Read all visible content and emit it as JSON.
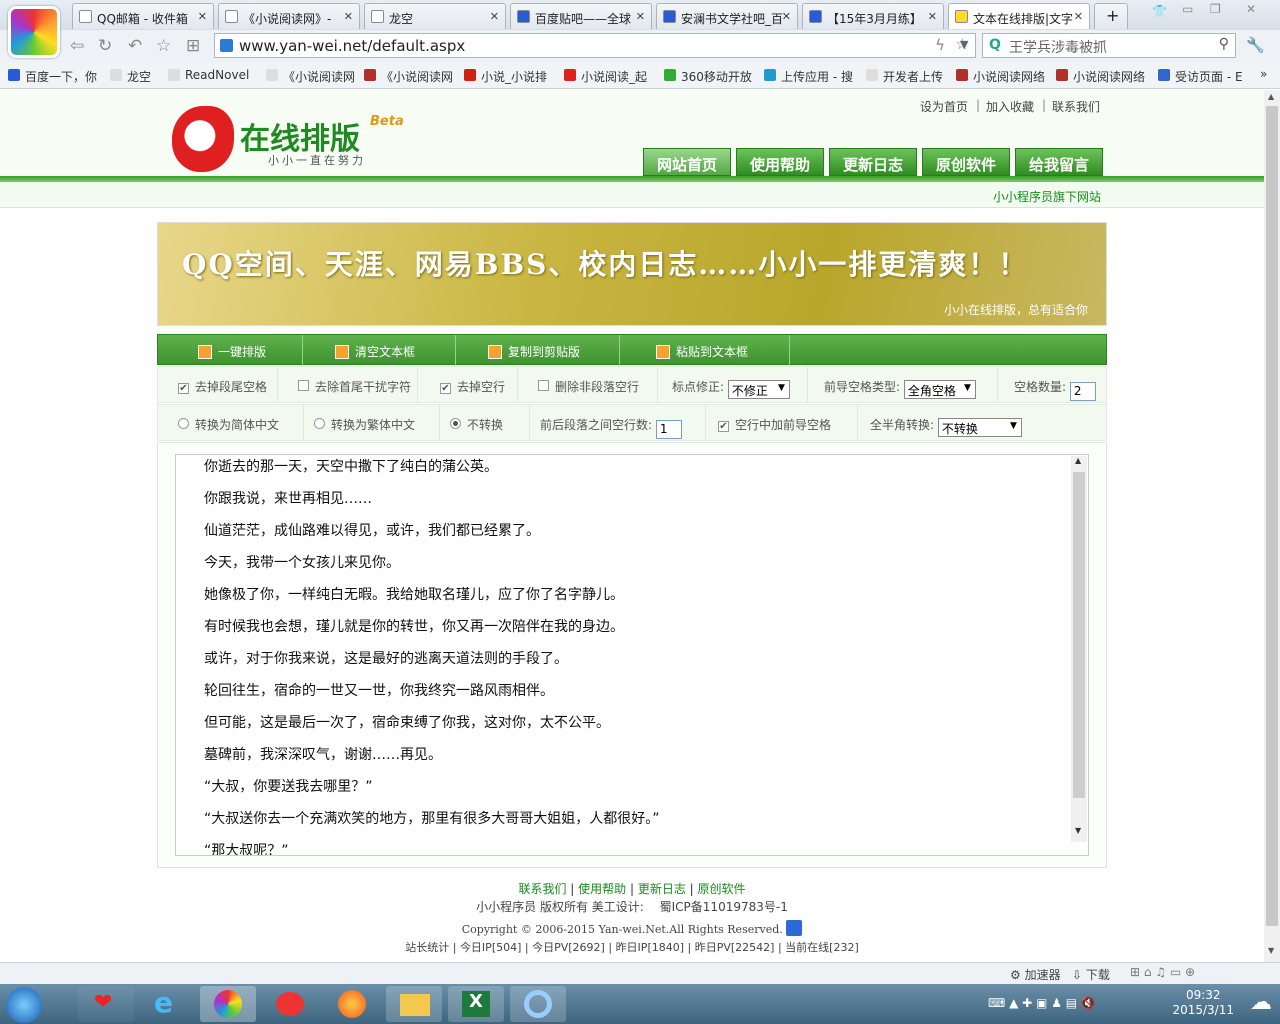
{
  "browser": {
    "tabs": [
      {
        "label": "QQ邮箱 - 收件箱"
      },
      {
        "label": "《小说阅读网》-"
      },
      {
        "label": "龙空"
      },
      {
        "label": "百度贴吧——全球"
      },
      {
        "label": "安澜书文学社吧_百"
      },
      {
        "label": "【15年3月月练】"
      },
      {
        "label": "文本在线排版|文字"
      }
    ],
    "new_tab": "+",
    "url": "www.yan-wei.net/default.aspx",
    "search_value": "王学兵涉毒被抓",
    "bookmarks": [
      {
        "label": "百度一下，你",
        "color": "#2a5bd7"
      },
      {
        "label": "龙空",
        "color": "#ddd"
      },
      {
        "label": "ReadNovel",
        "color": "#ddd"
      },
      {
        "label": "《小说阅读网",
        "color": "#ddd"
      },
      {
        "label": "《小说阅读网",
        "color": "#b0302a"
      },
      {
        "label": "小说_小说排",
        "color": "#c21"
      },
      {
        "label": "小说阅读_起",
        "color": "#d22"
      },
      {
        "label": "360移动开放",
        "color": "#3a3"
      },
      {
        "label": "上传应用 - 搜",
        "color": "#29c"
      },
      {
        "label": "开发者上传",
        "color": "#ddd"
      },
      {
        "label": "小说阅读网络",
        "color": "#b0302a"
      },
      {
        "label": "小说阅读网络",
        "color": "#b0302a"
      },
      {
        "label": "受访页面 - E",
        "color": "#36c"
      }
    ],
    "more": "»"
  },
  "site": {
    "logo_text": "在线排版",
    "logo_beta": "Beta",
    "logo_slogan": "小小一直在努力",
    "top_links": [
      "设为首页",
      "加入收藏",
      "联系我们"
    ],
    "nav": [
      "网站首页",
      "使用帮助",
      "更新日志",
      "原创软件",
      "给我留言"
    ],
    "subtitle": "小小程序员旗下网站",
    "banner_text": "QQ空间、天涯、网易BBS、校内日志……小小一排更清爽！！",
    "banner_small": "小小在线排版，总有适合你",
    "toolbar": [
      "一键排版",
      "清空文本框",
      "复制到剪贴版",
      "粘贴到文本框"
    ],
    "options1": {
      "trim_tail": {
        "label": "去掉段尾空格",
        "checked": true
      },
      "trim_junk": {
        "label": "去除首尾干扰字符",
        "checked": false
      },
      "remove_blank": {
        "label": "去掉空行",
        "checked": true
      },
      "remove_nonpara": {
        "label": "删除非段落空行",
        "checked": false
      },
      "punct_label": "标点修正:",
      "punct_value": "不修正",
      "lead_label": "前导空格类型:",
      "lead_value": "全角空格",
      "count_label": "空格数量:",
      "count_value": "2"
    },
    "options2": {
      "to_simplified": {
        "label": "转换为简体中文",
        "selected": false
      },
      "to_traditional": {
        "label": "转换为繁体中文",
        "selected": false
      },
      "no_convert": {
        "label": "不转换",
        "selected": true
      },
      "gap_label": "前后段落之间空行数:",
      "gap_value": "1",
      "blank_lead": {
        "label": "空行中加前导空格",
        "checked": true
      },
      "width_label": "全半角转换:",
      "width_value": "不转换"
    },
    "text_lines": [
      "你逝去的那一天，天空中撒下了纯白的蒲公英。",
      "你跟我说，来世再相见……",
      "仙道茫茫，成仙路难以得见，或许，我们都已经累了。",
      "今天，我带一个女孩儿来见你。",
      "她像极了你，一样纯白无暇。我给她取名瑾儿，应了你了名字静儿。",
      "有时候我也会想，瑾儿就是你的转世，你又再一次陪伴在我的身边。",
      "或许，对于你我来说，这是最好的逃离天道法则的手段了。",
      "轮回往生，宿命的一世又一世，你我终究一路风雨相伴。",
      "但可能，这是最后一次了，宿命束缚了你我，这对你，太不公平。",
      "墓碑前，我深深叹气，谢谢……再见。",
      "“大叔，你要送我去哪里？”",
      "“大叔送你去一个充满欢笑的地方，那里有很多大哥哥大姐姐，人都很好。”",
      "“那大叔呢？”"
    ],
    "footer": {
      "links": [
        "联系我们",
        "使用帮助",
        "更新日志",
        "原创软件"
      ],
      "copyright_line": "小小程序员 版权所有 美工设计:　 蜀ICP备11019783号-1",
      "copyright": "Copyright © 2006-2015 Yan-wei.Net.All Rights Reserved.",
      "stats": [
        "站长统计",
        "今日IP[504]",
        "今日PV[2692]",
        "昨日IP[1840]",
        "昨日PV[22542]",
        "当前在线[232]"
      ]
    }
  },
  "statusbar": {
    "accelerator": "加速器",
    "download": "下载"
  },
  "taskbar": {
    "time": "09:32",
    "date": "2015/3/11"
  },
  "colors": {
    "accent_green": "#3e9330",
    "link_green": "#1a8a1a"
  }
}
